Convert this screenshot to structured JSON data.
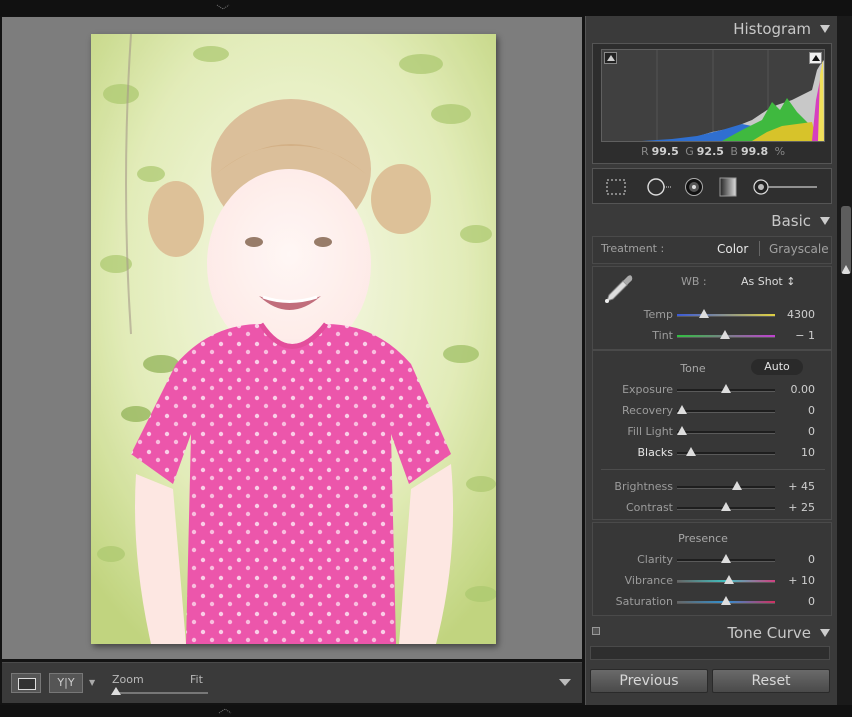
{
  "histogram": {
    "title": "Histogram",
    "r_label": "R",
    "r_value": "99.5",
    "g_label": "G",
    "g_value": "92.5",
    "b_label": "B",
    "b_value": "99.8",
    "percent": "%"
  },
  "tools": [
    "crop-overlay",
    "spot-removal",
    "red-eye-correction",
    "graduated-filter",
    "adjustment-brush"
  ],
  "basic": {
    "title": "Basic",
    "treatment_label": "Treatment :",
    "treatment_color": "Color",
    "treatment_grayscale": "Grayscale",
    "wb_label": "WB :",
    "wb_value": "As Shot ↕",
    "temp": {
      "label": "Temp",
      "value": "4300",
      "level": 0.25
    },
    "tint": {
      "label": "Tint",
      "value": "− 1",
      "level": 0.49
    },
    "tone_label": "Tone",
    "auto_label": "Auto",
    "exposure": {
      "label": "Exposure",
      "value": "0.00",
      "level": 0.5
    },
    "recovery": {
      "label": "Recovery",
      "value": "0",
      "level": 0.0
    },
    "fill_light": {
      "label": "Fill Light",
      "value": "0",
      "level": 0.0
    },
    "blacks": {
      "label": "Blacks",
      "value": "10",
      "level": 0.1
    },
    "brightness": {
      "label": "Brightness",
      "value": "+ 45",
      "level": 0.63
    },
    "contrast": {
      "label": "Contrast",
      "value": "+ 25",
      "level": 0.5
    },
    "presence_label": "Presence",
    "clarity": {
      "label": "Clarity",
      "value": "0",
      "level": 0.5
    },
    "vibrance": {
      "label": "Vibrance",
      "value": "+ 10",
      "level": 0.53
    },
    "saturation": {
      "label": "Saturation",
      "value": "0",
      "level": 0.5
    }
  },
  "tone_curve": {
    "title": "Tone Curve"
  },
  "buttons": {
    "previous": "Previous",
    "reset": "Reset"
  },
  "toolbar": {
    "yy_label": "Y|Y",
    "zoom_label": "Zoom",
    "fit_label": "Fit",
    "zoom_level": 0.0
  },
  "colors": {
    "photo_pink": "#e83a9a",
    "panel_bg": "#3a3a3a",
    "canvas_bg": "#7d7d7d"
  }
}
